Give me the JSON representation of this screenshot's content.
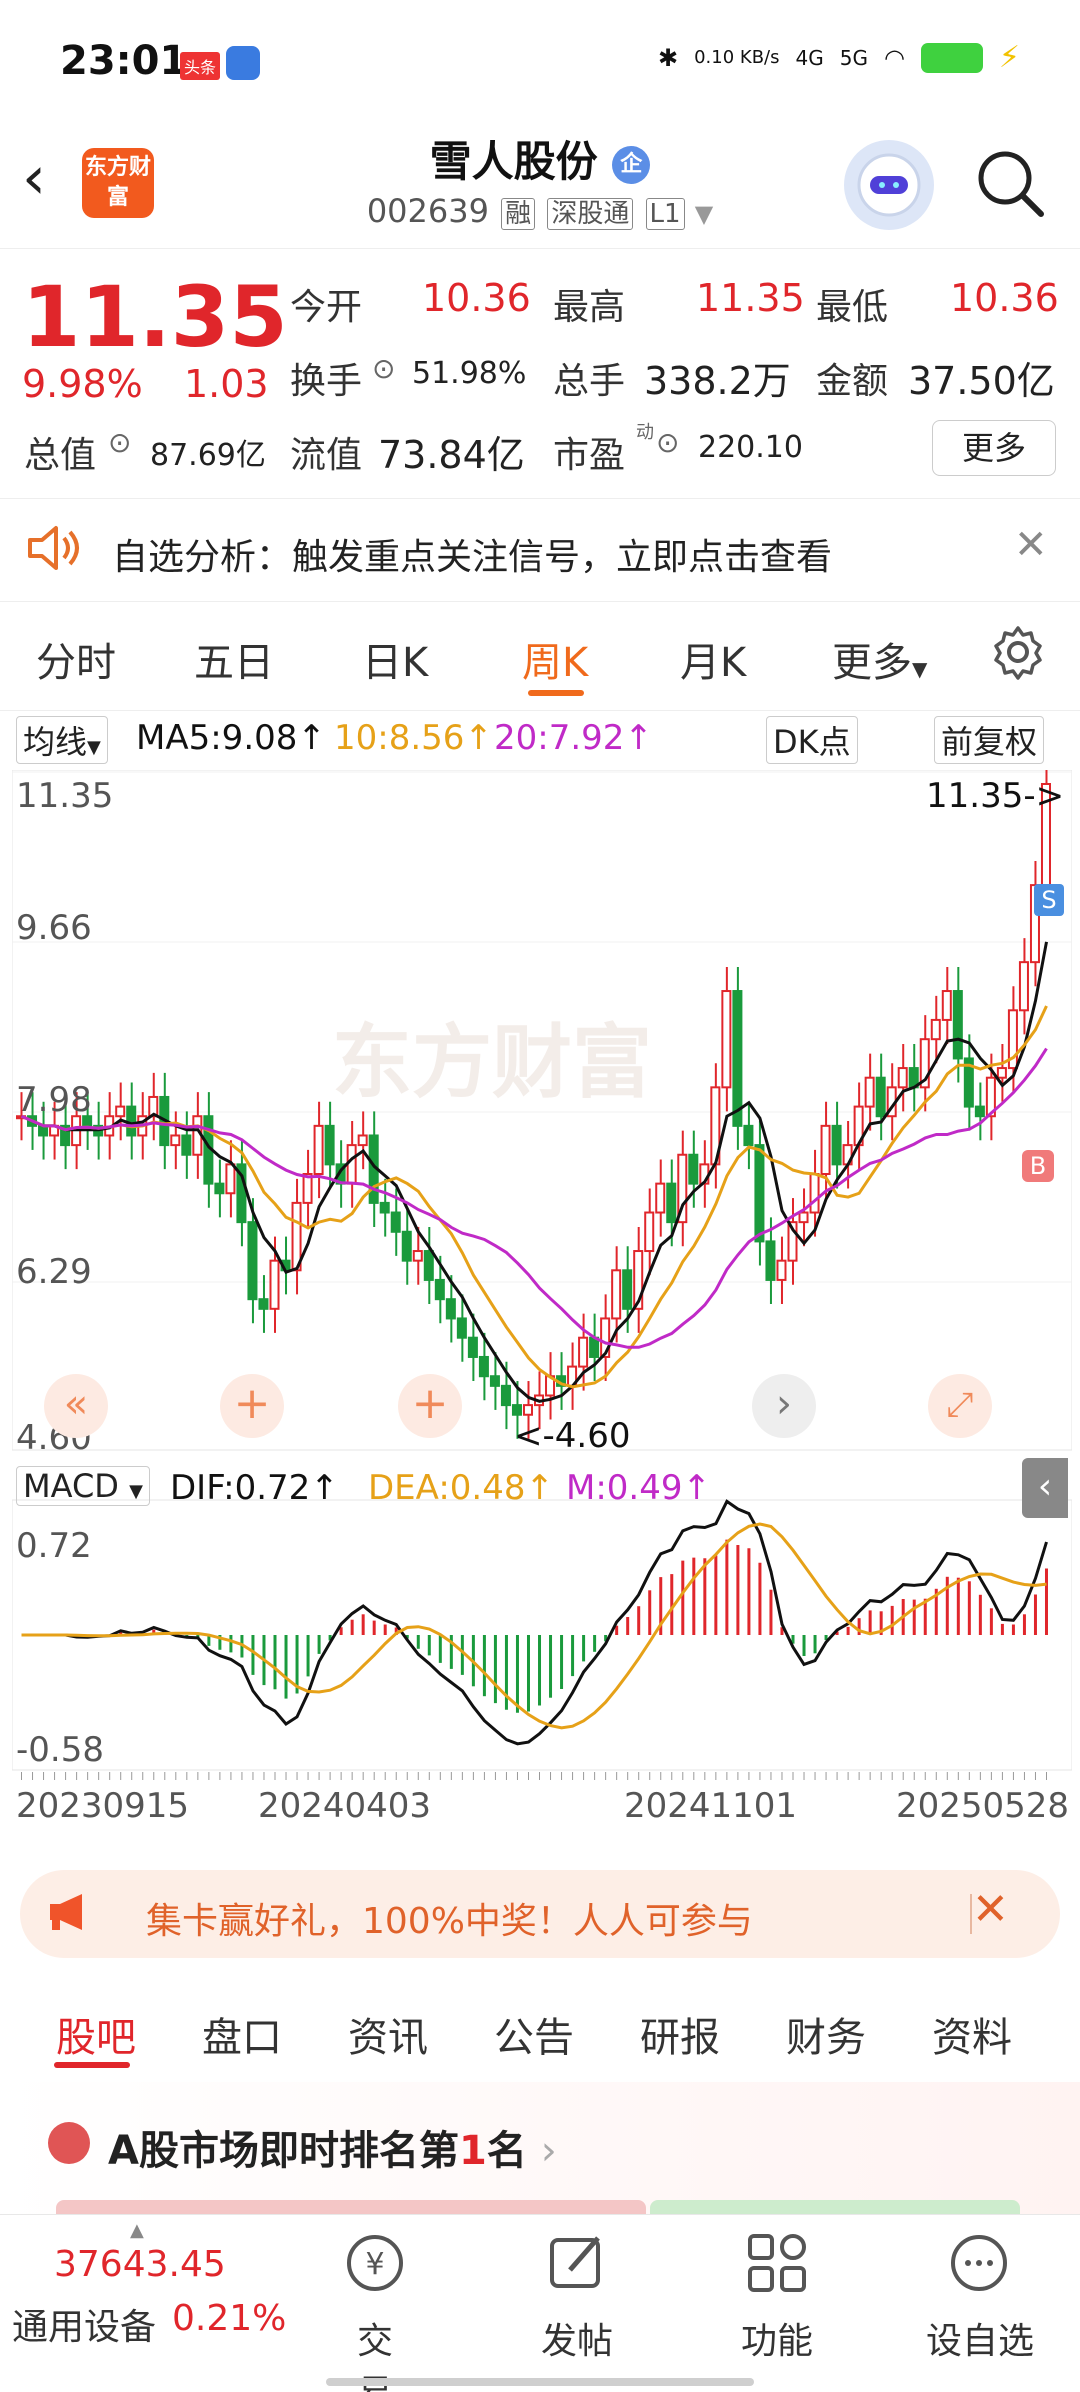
{
  "status_bar": {
    "time": "23:01",
    "news_badge": "头条",
    "net_speed": "0.10 KB/s",
    "net_4g": "4G",
    "net_5g": "5G"
  },
  "header": {
    "back_icon": "chevron-left-icon",
    "logo_text": "东方财富",
    "stock_name": "雪人股份",
    "enterprise_badge": "企",
    "stock_code": "002639",
    "tags": [
      "融",
      "深股通",
      "L1"
    ]
  },
  "quote": {
    "price": "11.35",
    "change_pct": "9.98%",
    "change": "1.03",
    "open_label": "今开",
    "open": "10.36",
    "high_label": "最高",
    "high": "11.35",
    "low_label": "最低",
    "low": "10.36",
    "turnover_label": "换手",
    "turnover": "51.98%",
    "volume_label": "总手",
    "volume": "338.2万",
    "amount_label": "金额",
    "amount": "37.50亿",
    "total_mv_label": "总值",
    "total_mv": "87.69亿",
    "float_mv_label": "流值",
    "float_mv": "73.84亿",
    "pe_label": "市盈",
    "pe_sup": "动",
    "pe": "220.10",
    "more_button": "更多"
  },
  "notice": {
    "text": "自选分析：触发重点关注信号，立即点击查看"
  },
  "chart_tabs": {
    "items": [
      "分时",
      "五日",
      "日K",
      "周K",
      "月K",
      "更多"
    ],
    "active": "周K"
  },
  "ma_bar": {
    "selector": "均线",
    "ma5": "MA5:9.08↑",
    "ma10": "10:8.56↑",
    "ma20": "20:7.92↑",
    "dk_button": "DK点",
    "adjust_button": "前复权"
  },
  "macd_bar": {
    "selector": "MACD",
    "dif": "DIF:0.72↑",
    "dea": "DEA:0.48↑",
    "m": "M:0.49↑"
  },
  "chart_data": {
    "type": "candlestick",
    "price_axis": [
      "11.35",
      "9.66",
      "7.98",
      "6.29",
      "4.60"
    ],
    "ylim": [
      4.6,
      11.35
    ],
    "latest_marker": "11.35->",
    "low_marker": "<-4.60",
    "macd_axis": [
      "0.72",
      "-0.58"
    ],
    "x_ticks": [
      "20230915",
      "20240403",
      "20241101",
      "20250528"
    ],
    "signal_sell": "S",
    "signal_buy": "B",
    "watermark": "东方财富",
    "colors": {
      "up": "#e0262b",
      "down": "#1a9a3c",
      "ma5": "#111111",
      "ma10": "#e6a118",
      "ma20": "#c02ac7"
    }
  },
  "ad": {
    "text": "集卡赢好礼，100%中奖！人人可参与"
  },
  "bottom_tabs": {
    "items": [
      "股吧",
      "盘口",
      "资讯",
      "公告",
      "研报",
      "财务",
      "资料"
    ],
    "active": "股吧"
  },
  "rank": {
    "text_prefix": "A股市场即时排名第",
    "rank_value": "1",
    "text_suffix": "名"
  },
  "bottom_nav": {
    "index_value": "37643.45",
    "index_name": "通用设备",
    "index_change": "0.21%",
    "items": [
      "交易",
      "发帖",
      "功能",
      "设自选"
    ]
  }
}
